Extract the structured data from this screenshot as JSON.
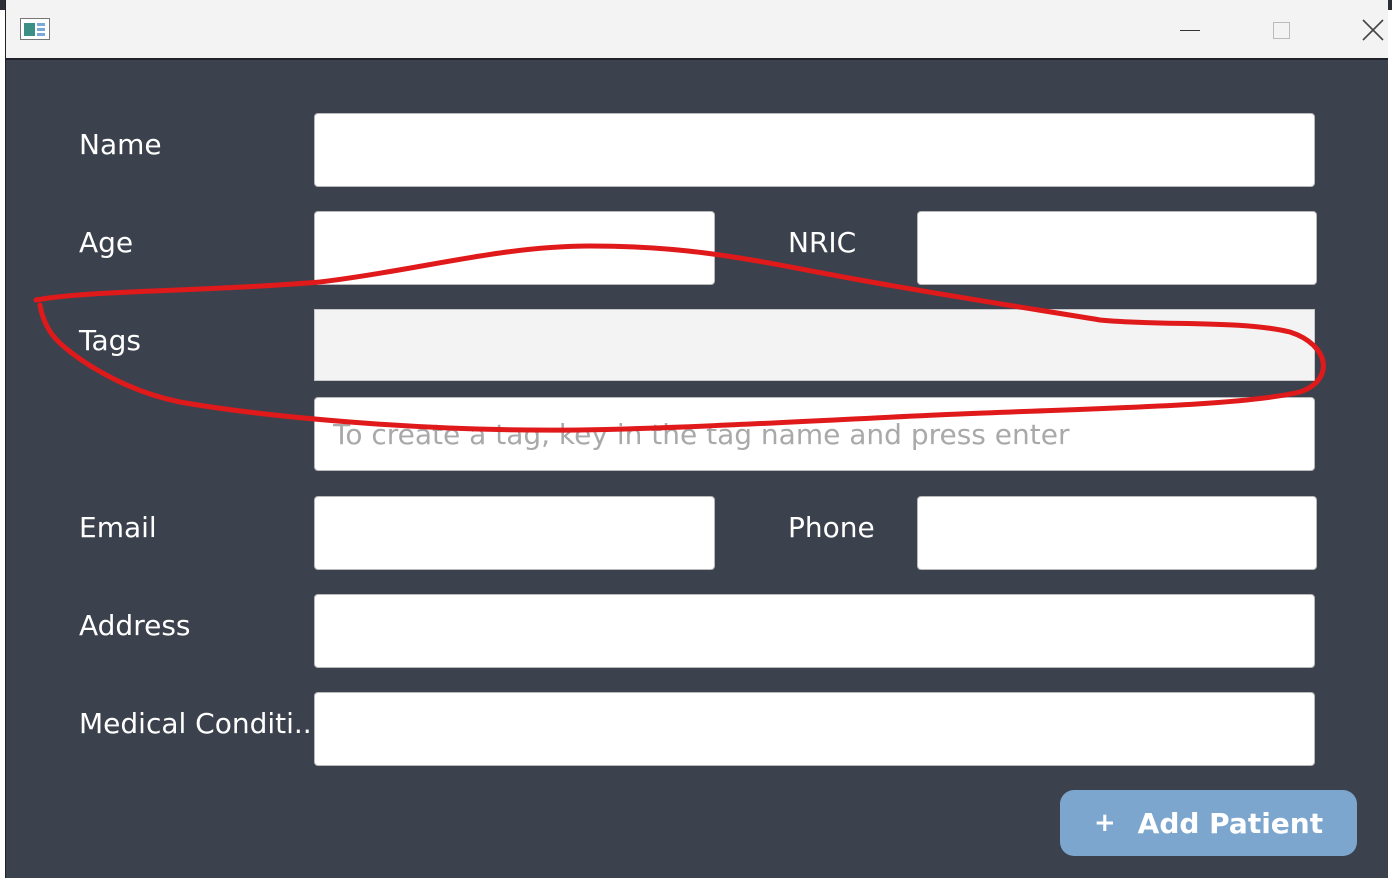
{
  "window": {
    "icon": "app-window-icon",
    "controls": {
      "minimize": "minimize-icon",
      "maximize": "maximize-icon",
      "close": "close-icon"
    }
  },
  "form": {
    "name_label": "Name",
    "name_value": "",
    "age_label": "Age",
    "age_value": "",
    "nric_label": "NRIC",
    "nric_value": "",
    "tags_label": "Tags",
    "tag_input_placeholder": "To create a tag, key in the tag name and press enter",
    "email_label": "Email",
    "email_value": "",
    "phone_label": "Phone",
    "phone_value": "",
    "address_label": "Address",
    "address_value": "",
    "medical_label": "Medical Conditi...",
    "medical_value": ""
  },
  "actions": {
    "add_icon": "+",
    "add_label": "Add Patient"
  },
  "colors": {
    "background": "#3c424d",
    "accent_button": "#7da6cf",
    "annotation_stroke": "#e0191b"
  }
}
